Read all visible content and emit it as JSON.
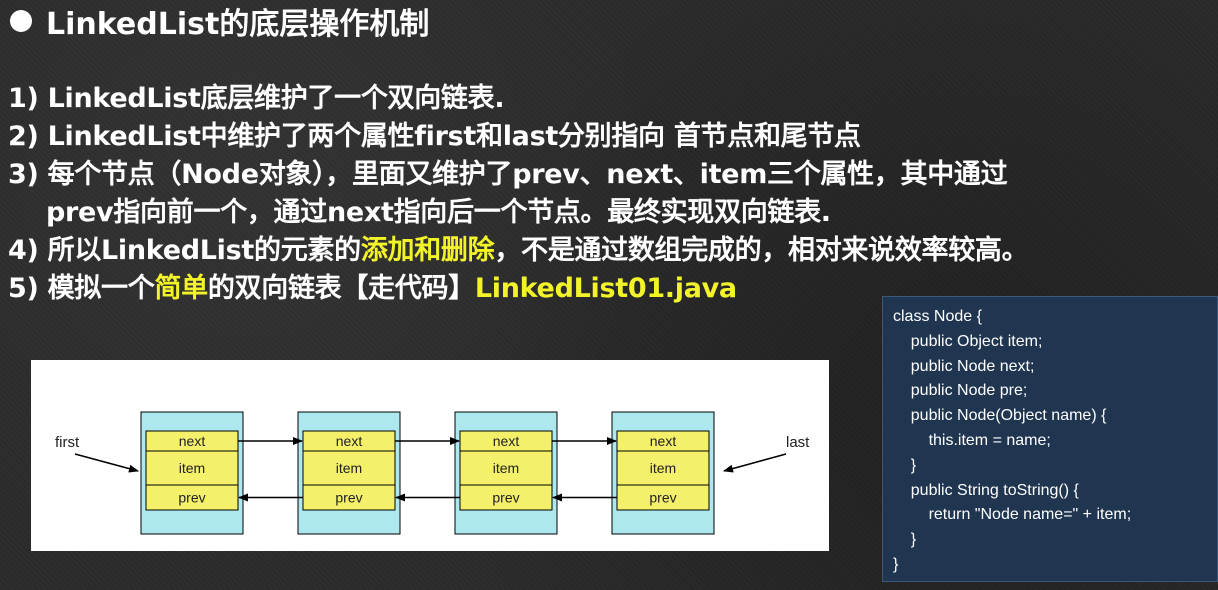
{
  "title": "LinkedList的底层操作机制",
  "points": [
    {
      "text": "1) LinkedList底层维护了一个双向链表."
    },
    {
      "text": "2) LinkedList中维护了两个属性first和last分别指向 首节点和尾节点"
    },
    {
      "line1": "3) 每个节点（Node对象），里面又维护了prev、next、item三个属性，其中通过",
      "line2": "prev指向前一个，通过next指向后一个节点。最终实现双向链表."
    },
    {
      "pre": "4) 所以LinkedList的元素的",
      "highlight": "添加和删除",
      "post": "，不是通过数组完成的，相对来说效率较高。"
    },
    {
      "pre": "5) 模拟一个",
      "highlight": "简单",
      "mid": "的双向链表【走代码】",
      "highlight2": "LinkedList01.java"
    }
  ],
  "diagram": {
    "first_label": "first",
    "last_label": "last",
    "nodes": [
      {
        "next": "next",
        "item": "item",
        "prev": "prev"
      },
      {
        "next": "next",
        "item": "item",
        "prev": "prev"
      },
      {
        "next": "next",
        "item": "item",
        "prev": "prev"
      },
      {
        "next": "next",
        "item": "item",
        "prev": "prev"
      }
    ],
    "colors": {
      "node_bg": "#aee8ef",
      "field_bg": "#f5f06a",
      "border": "#000000"
    }
  },
  "code": {
    "lines": [
      "class Node {",
      "    public Object item;",
      "    public Node next;",
      "    public Node pre;",
      "    public Node(Object name) {",
      "        this.item = name;",
      "    }",
      "    public String toString() {",
      "        return \"Node name=\" + item;",
      "    }",
      "}"
    ]
  },
  "colors": {
    "highlight": "#f3f32a",
    "code_bg": "#1f3550",
    "background": "#2b2b2b"
  }
}
